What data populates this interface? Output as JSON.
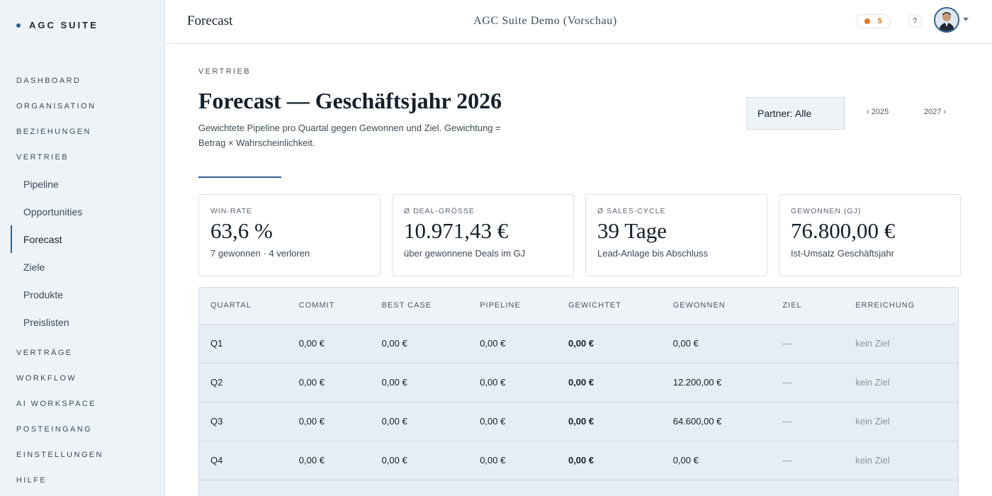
{
  "brand": {
    "name": "AGC SUITE"
  },
  "sidebar": {
    "sections": [
      {
        "label": "DASHBOARD"
      },
      {
        "label": "ORGANISATION"
      },
      {
        "label": "BEZIEHUNGEN"
      },
      {
        "label": "VERTRIEB",
        "items": [
          "Pipeline",
          "Opportunities",
          "Forecast",
          "Ziele",
          "Produkte",
          "Preislisten"
        ],
        "active_item": "Forecast"
      },
      {
        "label": "VERTRÄGE"
      },
      {
        "label": "WORKFLOW"
      },
      {
        "label": "AI WORKSPACE"
      },
      {
        "label": "POSTEINGANG"
      },
      {
        "label": "EINSTELLUNGEN"
      },
      {
        "label": "HILFE"
      }
    ]
  },
  "topbar": {
    "title": "Forecast",
    "workspace": "AGC Suite Demo (Vorschau)",
    "notification_count": "5",
    "help_label": "?",
    "accent_color": "#2d5f93",
    "notification_color": "#e07a1f"
  },
  "page": {
    "eyebrow": "VERTRIEB",
    "title": "Forecast — Geschäftsjahr 2026",
    "description": "Gewichtete Pipeline pro Quartal gegen Gewonnen und Ziel. Gewichtung = Betrag × Wahrscheinlichkeit.",
    "partner_filter": "Partner: Alle",
    "prev_year": "‹ 2025",
    "next_year": "2027 ›"
  },
  "kpis": [
    {
      "label": "WIN-RATE",
      "value": "63,6 %",
      "sub": "7 gewonnen · 4 verloren"
    },
    {
      "label": "Ø DEAL-GRÖSSE",
      "value": "10.971,43 €",
      "sub": "über gewonnene Deals im GJ"
    },
    {
      "label": "Ø SALES-CYCLE",
      "value": "39 Tage",
      "sub": "Lead-Anlage bis Abschluss"
    },
    {
      "label": "GEWONNEN (GJ)",
      "value": "76.800,00 €",
      "sub": "Ist-Umsatz Geschäftsjahr"
    }
  ],
  "table": {
    "headers": [
      "QUARTAL",
      "COMMIT",
      "BEST CASE",
      "PIPELINE",
      "GEWICHTET",
      "GEWONNEN",
      "ZIEL",
      "ERREICHUNG"
    ],
    "rows": [
      [
        "Q1",
        "0,00 €",
        "0,00 €",
        "0,00 €",
        "0,00 €",
        "0,00 €",
        "—",
        "kein Ziel"
      ],
      [
        "Q2",
        "0,00 €",
        "0,00 €",
        "0,00 €",
        "0,00 €",
        "12.200,00 €",
        "—",
        "kein Ziel"
      ],
      [
        "Q3",
        "0,00 €",
        "0,00 €",
        "0,00 €",
        "0,00 €",
        "64.600,00 €",
        "—",
        "kein Ziel"
      ],
      [
        "Q4",
        "0,00 €",
        "0,00 €",
        "0,00 €",
        "0,00 €",
        "0,00 €",
        "—",
        "kein Ziel"
      ]
    ]
  }
}
